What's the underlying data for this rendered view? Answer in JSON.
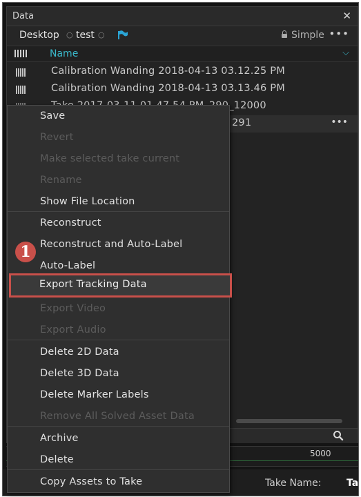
{
  "panel": {
    "title": "Data",
    "close_glyph": "✕"
  },
  "breadcrumb": {
    "item1": "Desktop",
    "item2": "test",
    "sep": "○",
    "mode": "Simple",
    "more": "•••"
  },
  "table": {
    "header_name": "Name",
    "rows": [
      {
        "label": "Calibration Wanding 2018-04-13 03.12.25 PM"
      },
      {
        "label": "Calibration Wanding 2018-04-13 03.13.46 PM"
      },
      {
        "label": "Take 2017-03-11 01.47.54 PM_290_12000"
      },
      {
        "label": "291"
      }
    ],
    "row_more": "•••"
  },
  "context_menu": {
    "items": [
      {
        "label": "Save",
        "enabled": true
      },
      {
        "label": "Revert",
        "enabled": false
      },
      {
        "label": "Make selected take current",
        "enabled": false
      },
      {
        "label": "Rename",
        "enabled": false
      },
      {
        "label": "Show File Location",
        "enabled": true
      },
      {
        "label": "Reconstruct",
        "enabled": true
      },
      {
        "label": "Reconstruct and Auto-Label",
        "enabled": true
      },
      {
        "label": "Auto-Label",
        "enabled": true
      },
      {
        "label": "Export Tracking Data",
        "enabled": true,
        "highlighted": true
      },
      {
        "label": "Export Video",
        "enabled": false
      },
      {
        "label": "Export Audio",
        "enabled": false
      },
      {
        "label": "Delete 2D Data",
        "enabled": true
      },
      {
        "label": "Delete 3D Data",
        "enabled": true
      },
      {
        "label": "Delete Marker Labels",
        "enabled": true
      },
      {
        "label": "Remove All Solved Asset Data",
        "enabled": false
      },
      {
        "label": "Archive",
        "enabled": true
      },
      {
        "label": "Delete",
        "enabled": true
      },
      {
        "label": "Copy Assets to Take",
        "enabled": true
      }
    ]
  },
  "annotation": {
    "step": "1",
    "color": "#c9504a"
  },
  "timeline": {
    "tick_label": "5000"
  },
  "bottom": {
    "take_name_label": "Take Name:",
    "take_name_value": "Ta"
  },
  "icons": [
    "close-icon",
    "flag-icon",
    "lock-icon",
    "more-icon",
    "columns-icon",
    "chevron-down-icon",
    "search-icon"
  ]
}
